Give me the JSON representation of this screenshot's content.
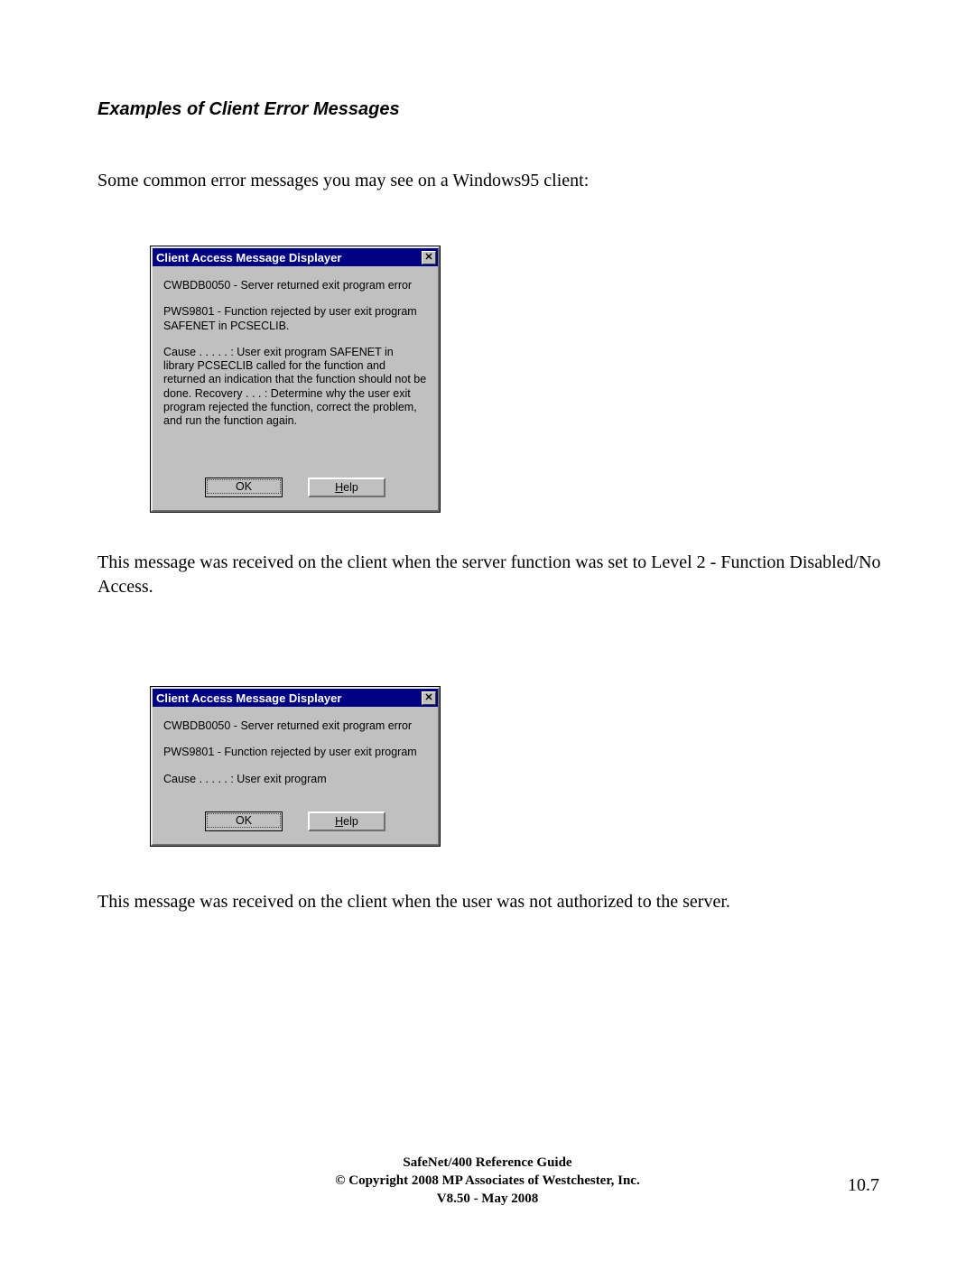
{
  "heading": "Examples of Client Error Messages",
  "intro": "Some common error messages you may see on a Windows95 client:",
  "dialog1": {
    "title": "Client Access Message Displayer",
    "close_glyph": "✕",
    "line1": "CWBDB0050 - Server returned exit program error",
    "line2": "PWS9801 - Function rejected by user exit program SAFENET in PCSECLIB.",
    "line3": "Cause . . . . . :   User exit program SAFENET in library PCSECLIB  called for the function and returned an indication that the function should not be done.  Recovery  . . . :   Determine why the user exit program rejected the function, correct the problem, and run the function again.",
    "ok_label": "OK",
    "help_label": "Help"
  },
  "caption1": "This message was received on the client when the server function was set to Level 2 - Function Disabled/No Access.",
  "dialog2": {
    "title": "Client Access Message Displayer",
    "close_glyph": "✕",
    "line1": "CWBDB0050 - Server returned exit program error",
    "line2": "PWS9801 - Function rejected by user exit program",
    "line3": "Cause . . . . . :   User exit program",
    "ok_label": "OK",
    "help_label": "Help"
  },
  "caption2": "This message was received on the client when the user was not authorized to the server.",
  "footer": {
    "line1": "SafeNet/400 Reference Guide",
    "line2": "Copyright 2008 MP Associates of Westchester, Inc.",
    "line3": "V8.50  -  May 2008"
  },
  "page_number": "10.7"
}
